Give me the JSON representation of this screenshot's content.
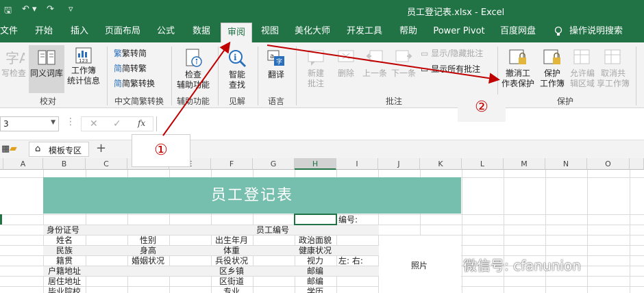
{
  "title_bar": {
    "file_title": "员工登记表.xlsx  -  Excel",
    "bg": "#217346"
  },
  "tabs": [
    {
      "label": "文件"
    },
    {
      "label": "开始"
    },
    {
      "label": "插入"
    },
    {
      "label": "页面布局"
    },
    {
      "label": "公式"
    },
    {
      "label": "数据"
    },
    {
      "label": "审阅",
      "active": true
    },
    {
      "label": "视图"
    },
    {
      "label": "美化大师"
    },
    {
      "label": "开发工具"
    },
    {
      "label": "帮助"
    },
    {
      "label": "Power Pivot"
    },
    {
      "label": "百度网盘"
    },
    {
      "label": "操作说明搜索"
    }
  ],
  "ribbon": {
    "proofing": {
      "spell": "写检查",
      "thesaurus": "同义词库",
      "stats_1": "工作簿",
      "stats_2": "统计信息",
      "label": "校对"
    },
    "chinese": {
      "to_simplified": "繁转简",
      "to_traditional": "简转繁",
      "convert": "简繁转换",
      "label": "中文简繁转换"
    },
    "accessibility": {
      "check_1": "检查",
      "check_2": "辅助功能",
      "label": "辅助功能"
    },
    "insights": {
      "smart_1": "智能",
      "smart_2": "查找",
      "label": "见解"
    },
    "language": {
      "translate": "翻译",
      "label": "语言"
    },
    "comments": {
      "new_1": "新建",
      "new_2": "批注",
      "delete": "删除",
      "prev": "上一条",
      "next": "下一条",
      "show_hide": "显示/隐藏批注",
      "show_all": "显示所有批注",
      "label": "批注"
    },
    "protect": {
      "unprotect_1": "撤消工",
      "unprotect_2": "作表保护",
      "protect_wb_1": "保护",
      "protect_wb_2": "工作簿",
      "allow_1": "允许编",
      "allow_2": "辑区域",
      "unshare_1": "取消共",
      "unshare_2": "享工作簿",
      "label": "保护"
    }
  },
  "formula_bar": {
    "name_box": "3",
    "fx": "fx"
  },
  "file_tabs": {
    "template_tab": "模板专区",
    "add": "+"
  },
  "columns": [
    "A",
    "B",
    "C",
    "D",
    "E",
    "F",
    "G",
    "H",
    "I",
    "J",
    "K",
    "L",
    "M",
    "N",
    "O"
  ],
  "sheet": {
    "title": "员工登记表",
    "number_label": "编号:",
    "rows": {
      "id_card": "身份证号",
      "emp_no": "员工编号",
      "name": "姓名",
      "gender": "性别",
      "birth": "出生年月",
      "politics": "政治面貌",
      "ethnic": "民族",
      "height": "身高",
      "weight": "体重",
      "health": "健康状况",
      "native": "籍贯",
      "marital": "婚姻状况",
      "military": "兵役状况",
      "vision": "视力",
      "lr": "左:   右:",
      "household": "户籍地址",
      "township": "区乡镇",
      "postcode1": "邮编",
      "residence": "居住地址",
      "street": "区街道",
      "postcode2": "邮编",
      "school": "毕业院校",
      "major": "专业",
      "education": "学历",
      "photo": "照片"
    }
  },
  "annotations": {
    "one": "①",
    "two": "②",
    "color": "#c00000"
  },
  "watermark": "微信号: cfanunion"
}
